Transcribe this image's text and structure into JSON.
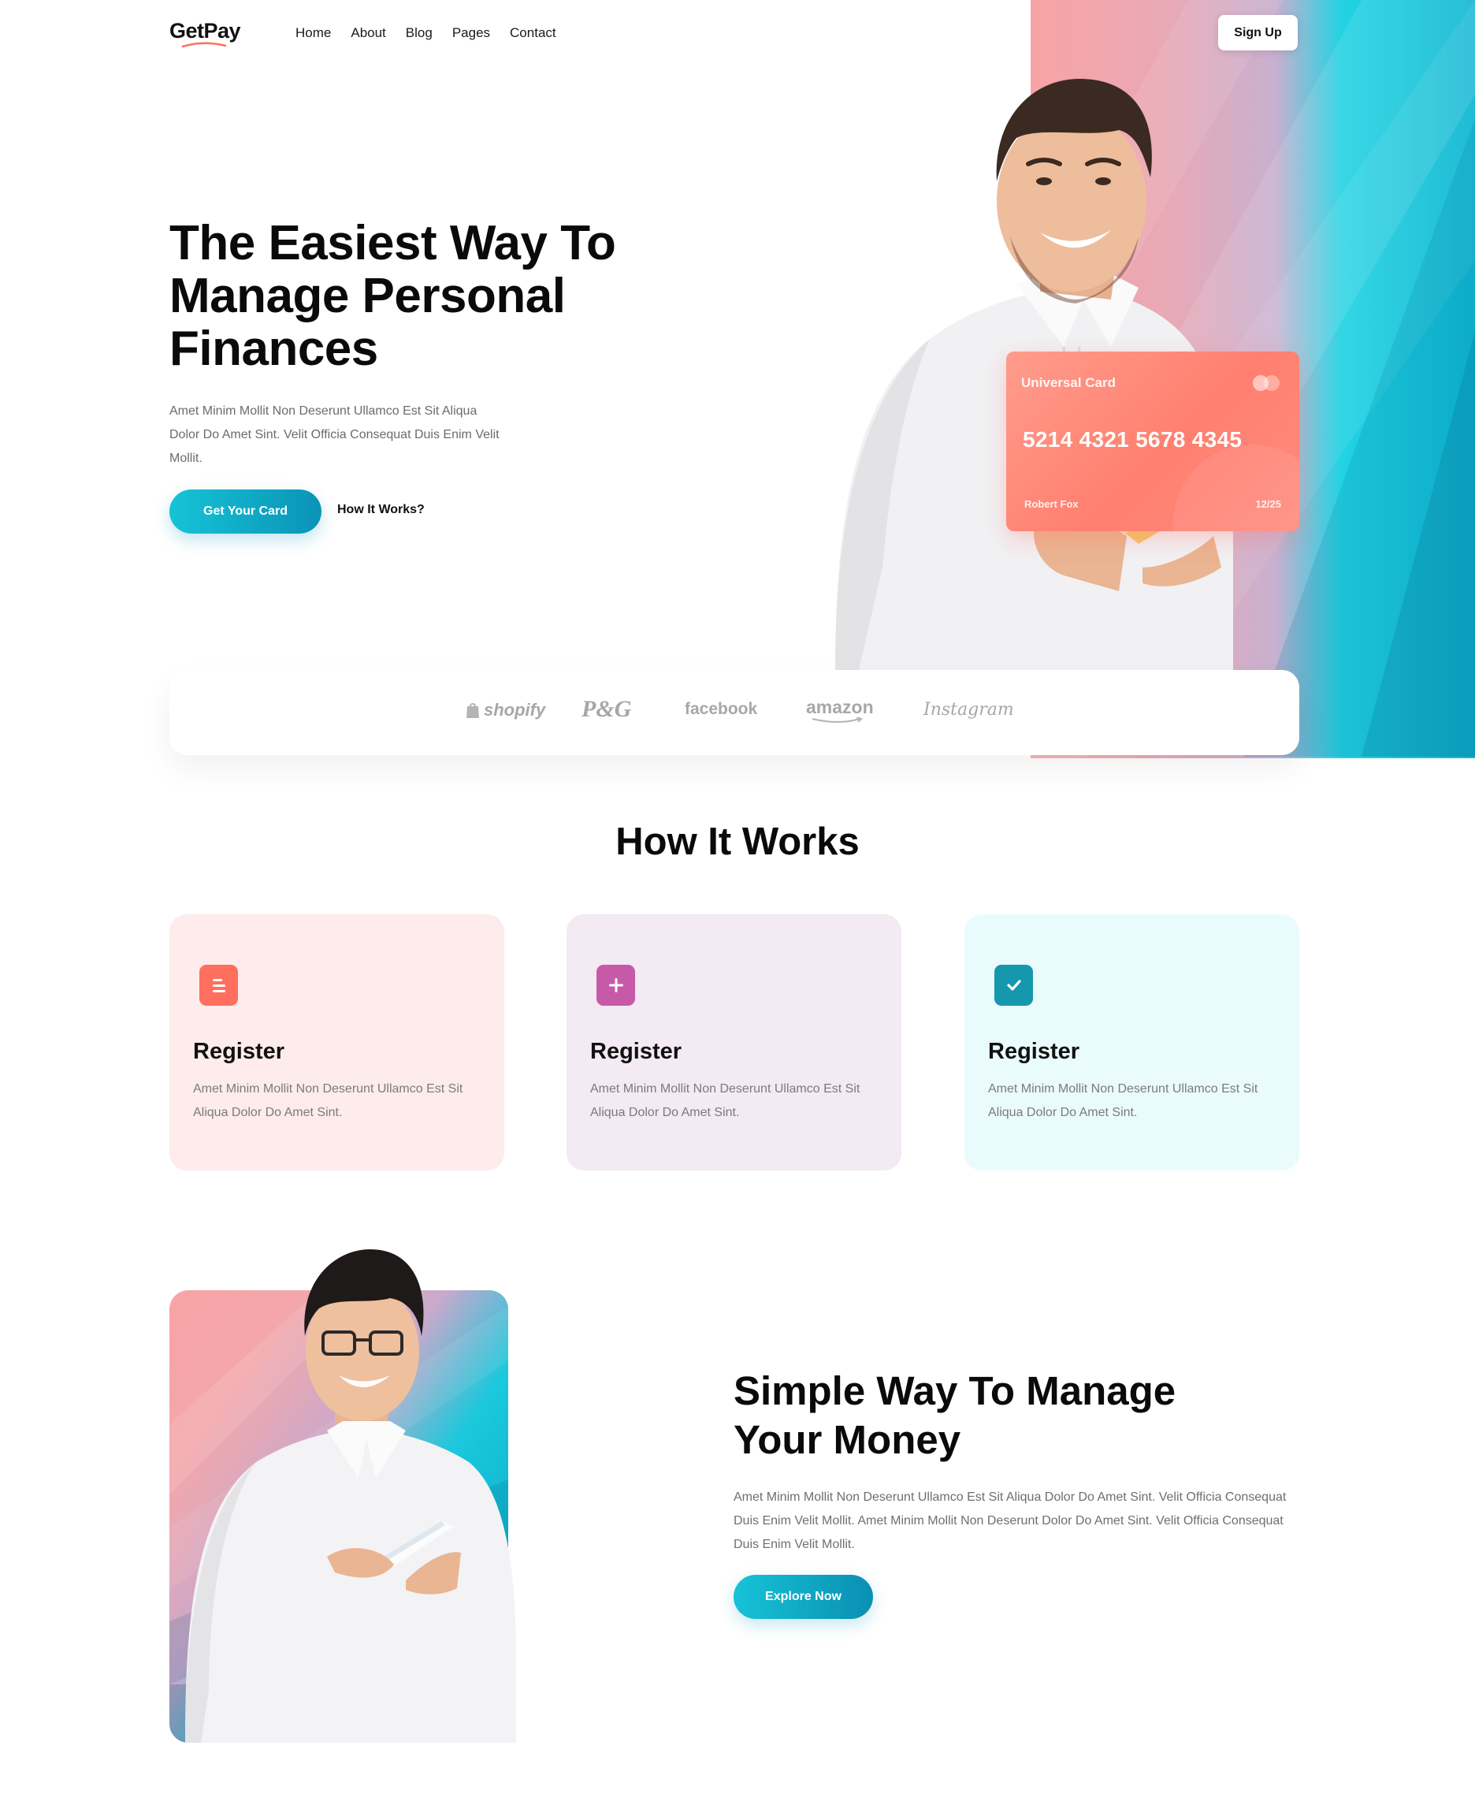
{
  "header": {
    "logo": "GetPay",
    "nav": [
      "Home",
      "About",
      "Blog",
      "Pages",
      "Contact"
    ],
    "signup_label": "Sign Up"
  },
  "hero": {
    "title": "The Easiest Way To Manage Personal Finances",
    "description": "Amet Minim Mollit Non Deserunt Ullamco Est Sit Aliqua Dolor Do Amet Sint. Velit Officia Consequat Duis Enim Velit Mollit.",
    "primary_button": "Get Your Card",
    "secondary_link": "How It Works?",
    "card": {
      "title": "Universal Card",
      "number": "5214 4321 5678 4345",
      "holder": "Robert Fox",
      "expiry": "12/25"
    }
  },
  "brands": [
    "shopify",
    "P&G",
    "facebook",
    "amazon",
    "Instagram"
  ],
  "how_it_works": {
    "title": "How It Works",
    "steps": [
      {
        "title": "Register",
        "description": "Amet Minim Mollit Non Deserunt Ullamco Est Sit Aliqua Dolor Do Amet Sint.",
        "icon": "list-icon"
      },
      {
        "title": "Register",
        "description": "Amet Minim Mollit Non Deserunt Ullamco Est Sit Aliqua Dolor Do Amet Sint.",
        "icon": "plus-icon"
      },
      {
        "title": "Register",
        "description": "Amet Minim Mollit Non Deserunt Ullamco Est Sit Aliqua Dolor Do Amet Sint.",
        "icon": "check-icon"
      }
    ]
  },
  "feature": {
    "title": "Simple Way To Manage Your Money",
    "description": "Amet Minim Mollit Non Deserunt Ullamco Est Sit Aliqua Dolor Do Amet Sint. Velit Officia Consequat Duis Enim Velit Mollit. Amet Minim Mollit Non Deserunt Dolor Do Amet Sint. Velit Officia Consequat Duis Enim Velit Mollit.",
    "button": "Explore Now"
  },
  "colors": {
    "accent": "#10b7d2",
    "coral": "#ff7f6f",
    "pink": "#f8a3a5",
    "purple": "#c75aa8"
  }
}
